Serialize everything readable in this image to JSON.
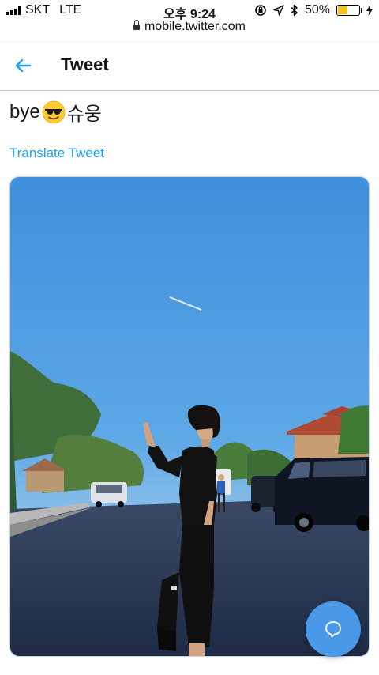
{
  "status_bar": {
    "carrier": "SKT",
    "network": "LTE",
    "time": "오후 9:24",
    "battery_percent": "50%",
    "battery_level": 0.5,
    "battery_color": "#f5c31b"
  },
  "url_bar": {
    "url": "mobile.twitter.com"
  },
  "header": {
    "title": "Tweet",
    "back_icon": "arrow-left-icon"
  },
  "tweet": {
    "text_before": "bye",
    "emoji": "sunglasses-emoji-icon",
    "text_after": "슈웅",
    "translate_label": "Translate Tweet",
    "media": "photo"
  },
  "fab": {
    "icon": "reply-bubble-icon"
  },
  "colors": {
    "accent": "#1da1f2",
    "fab": "#4a99e9"
  }
}
